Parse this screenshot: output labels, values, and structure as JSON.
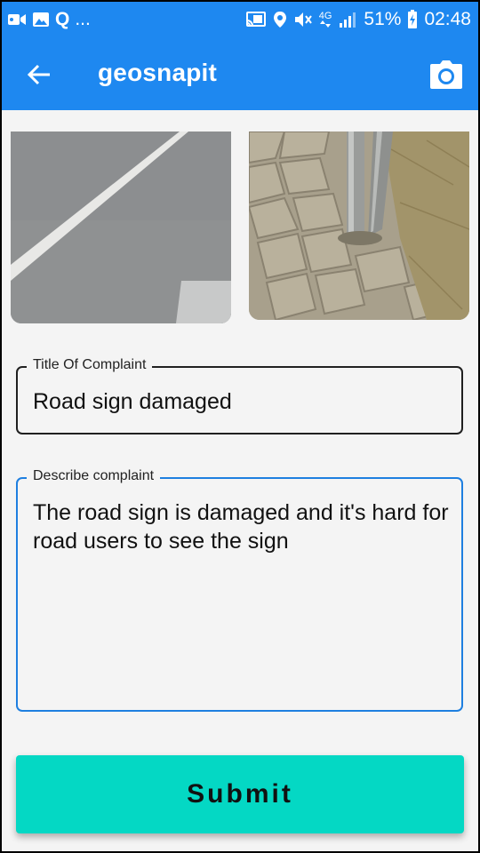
{
  "status_bar": {
    "ellipsis": "...",
    "search_glyph": "Q",
    "network_type": "4G",
    "battery": "51%",
    "time": "02:48"
  },
  "app_bar": {
    "title": "geosnapit",
    "back_icon": "arrow-left-icon",
    "action_icon": "camera-icon"
  },
  "photos": [
    {
      "description_icon": "road-photo"
    },
    {
      "description_icon": "pole-photo"
    }
  ],
  "form": {
    "title_label": "Title Of Complaint",
    "title_value": "Road sign damaged",
    "description_label": "Describe complaint",
    "description_value": "The road sign is damaged and it's hard for road users to see the sign"
  },
  "submit_label": "Submit",
  "colors": {
    "app_bar": "#1e88f0",
    "submit": "#04d8c4",
    "focused_border": "#1e7fe0"
  }
}
